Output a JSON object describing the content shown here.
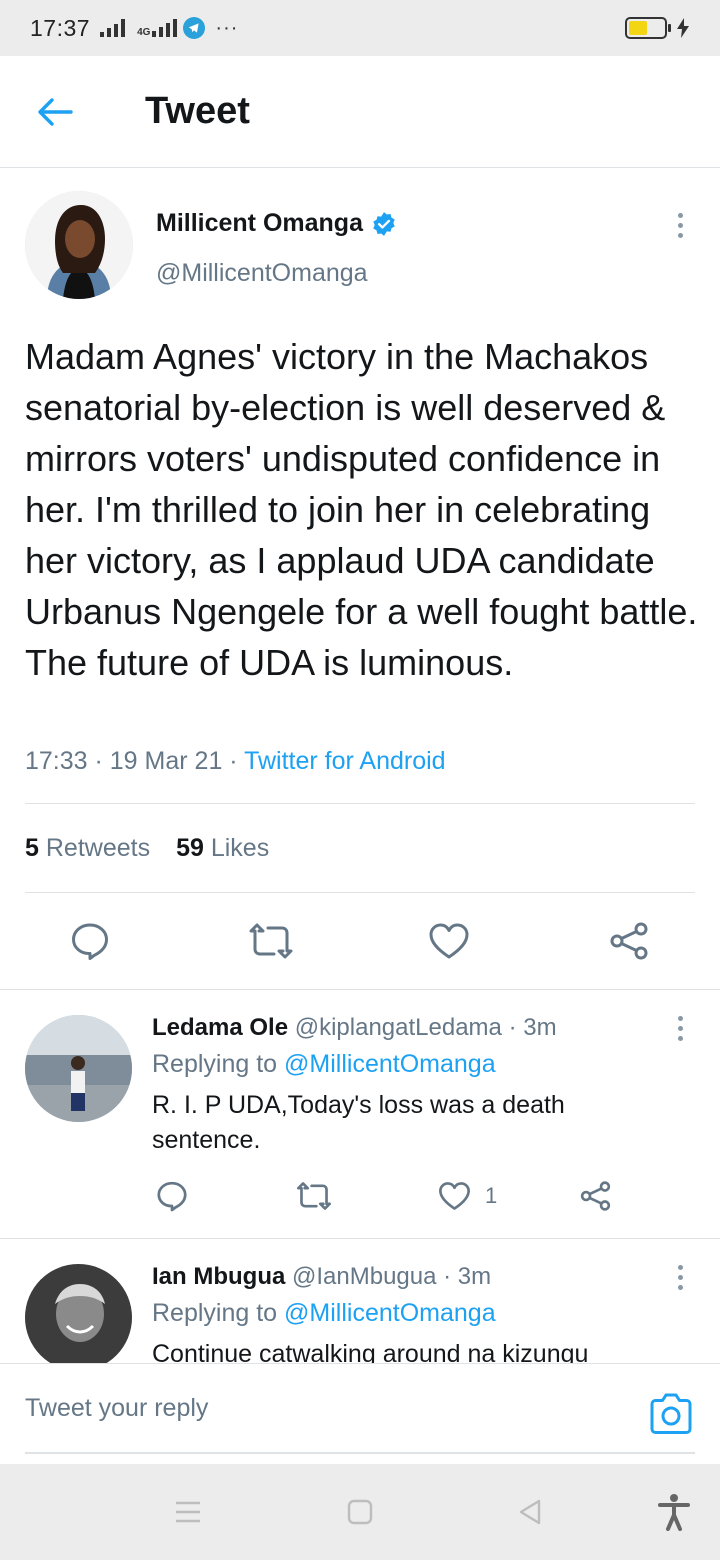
{
  "status_bar": {
    "time": "17:37",
    "network_label": "4G",
    "more": "···"
  },
  "header": {
    "title": "Tweet"
  },
  "main_tweet": {
    "author_name": "Millicent Omanga",
    "author_handle": "@MillicentOmanga",
    "text": "Madam Agnes' victory in the Machakos senatorial by-election is well deserved & mirrors voters' undisputed confidence in her. I'm thrilled to join her in celebrating her victory, as I applaud UDA candidate Urbanus Ngengele for a well fought battle. The future of UDA is luminous.",
    "time": "17:33",
    "date": "19 Mar 21",
    "source": "Twitter for Android",
    "meta_sep": " · ",
    "retweets_count": "5",
    "retweets_label": "Retweets",
    "likes_count": "59",
    "likes_label": "Likes"
  },
  "replies": [
    {
      "name": "Ledama Ole",
      "handle": "@kiplangatLedama",
      "time": "· 3m",
      "replying_label": "Replying to",
      "replying_to": "@MillicentOmanga",
      "text": "R. I. P UDA,Today's loss was a death sentence.",
      "like_count": "1"
    },
    {
      "name": "Ian Mbugua",
      "handle": "@IanMbugua",
      "time": "· 3m",
      "replying_label": "Replying to",
      "replying_to": "@MillicentOmanga",
      "text": "Continue catwalking around na kizungu"
    }
  ],
  "composer": {
    "placeholder": "Tweet your reply"
  },
  "colors": {
    "accent": "#1da1f2",
    "secondary_text": "#657786",
    "primary_text": "#14171a",
    "divider": "#dfe3e6",
    "system_bar": "#ececec"
  },
  "icons": {
    "back": "arrow-left-icon",
    "verified": "verified-badge-icon",
    "reply": "reply-bubble-icon",
    "retweet": "retweet-icon",
    "like": "heart-icon",
    "share": "share-icon",
    "camera": "camera-icon",
    "more": "more-vertical-icon"
  }
}
